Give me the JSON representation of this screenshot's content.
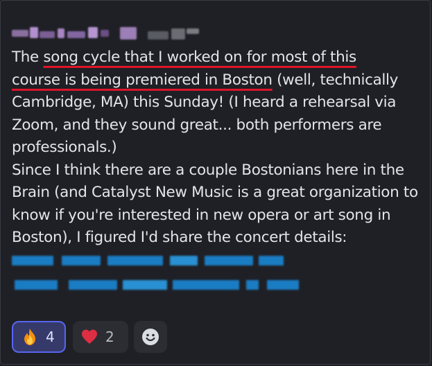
{
  "message": {
    "seg_intro": "The ",
    "seg_u1": "song cycle that I worked on for most of this",
    "seg_u2": "course is being premiered in Boston",
    "seg_rest1": " (well, technically Cambridge, MA) this Sunday! (I heard a rehearsal via Zoom, and they sound great... both performers are professionals.)",
    "para2": "Since I think there are a couple Bostonians here in the Brain (and Catalyst New Music is a great organization to know if you're interested in new opera or art song in Boston), I figured I'd share the concert details:"
  },
  "reactions": [
    {
      "emoji": "fire-emoji",
      "count": "4",
      "selected": true
    },
    {
      "emoji": "heart-emoji",
      "count": "2",
      "selected": false
    }
  ],
  "colors": {
    "underline": "#e0142a",
    "link_blur": "#1a86d4",
    "selected_border": "#5865f2"
  }
}
